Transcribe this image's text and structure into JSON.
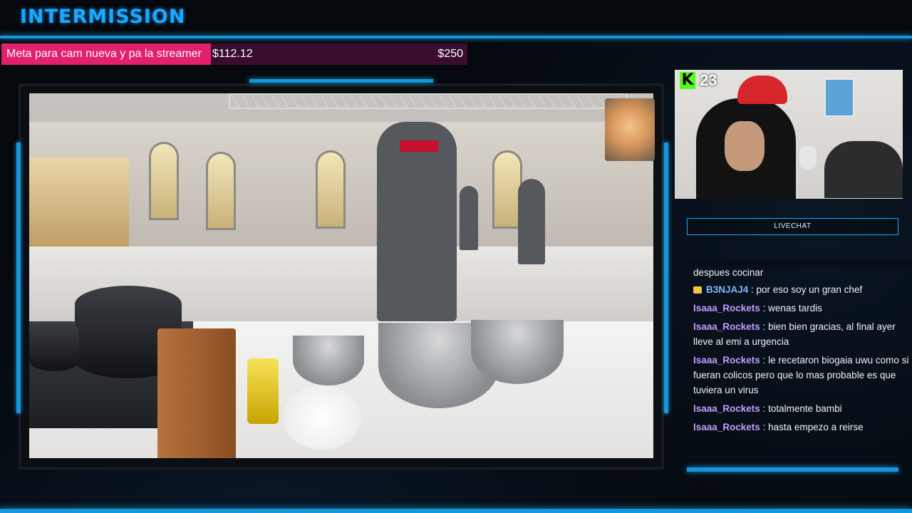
{
  "overlay": {
    "title": "INTERMISSION",
    "accent_color": "#1596d8",
    "title_color": "#1aa7ff"
  },
  "goal": {
    "label": "Meta para cam nueva y pa la streamer",
    "current": "$112.12",
    "target": "$250",
    "progress_fraction": 0.449,
    "fill_color": "#e3206a"
  },
  "stream": {
    "platform_icon": "kick-logo-icon",
    "viewer_count": "23",
    "platform_letter": "K"
  },
  "chat": {
    "header": "LIVECHAT",
    "partial_top": "despues cocinar",
    "messages": [
      {
        "user": "B3NJAJ4",
        "badge": true,
        "text": ": por eso soy un gran chef"
      },
      {
        "user": "Isaaa_Rockets",
        "badge": false,
        "text": ": wenas tardis"
      },
      {
        "user": "Isaaa_Rockets",
        "badge": false,
        "text": ": bien bien gracias, al final ayer lleve al emi a urgencia"
      },
      {
        "user": "Isaaa_Rockets",
        "badge": false,
        "text": ": le recetaron biogaia uwu como si fueran colicos pero que lo mas probable es que tuviera un virus"
      },
      {
        "user": "Isaaa_Rockets",
        "badge": false,
        "text": ": totalmente bambi"
      },
      {
        "user": "Isaaa_Rockets",
        "badge": false,
        "text": ": hasta empezo a reirse"
      }
    ]
  }
}
